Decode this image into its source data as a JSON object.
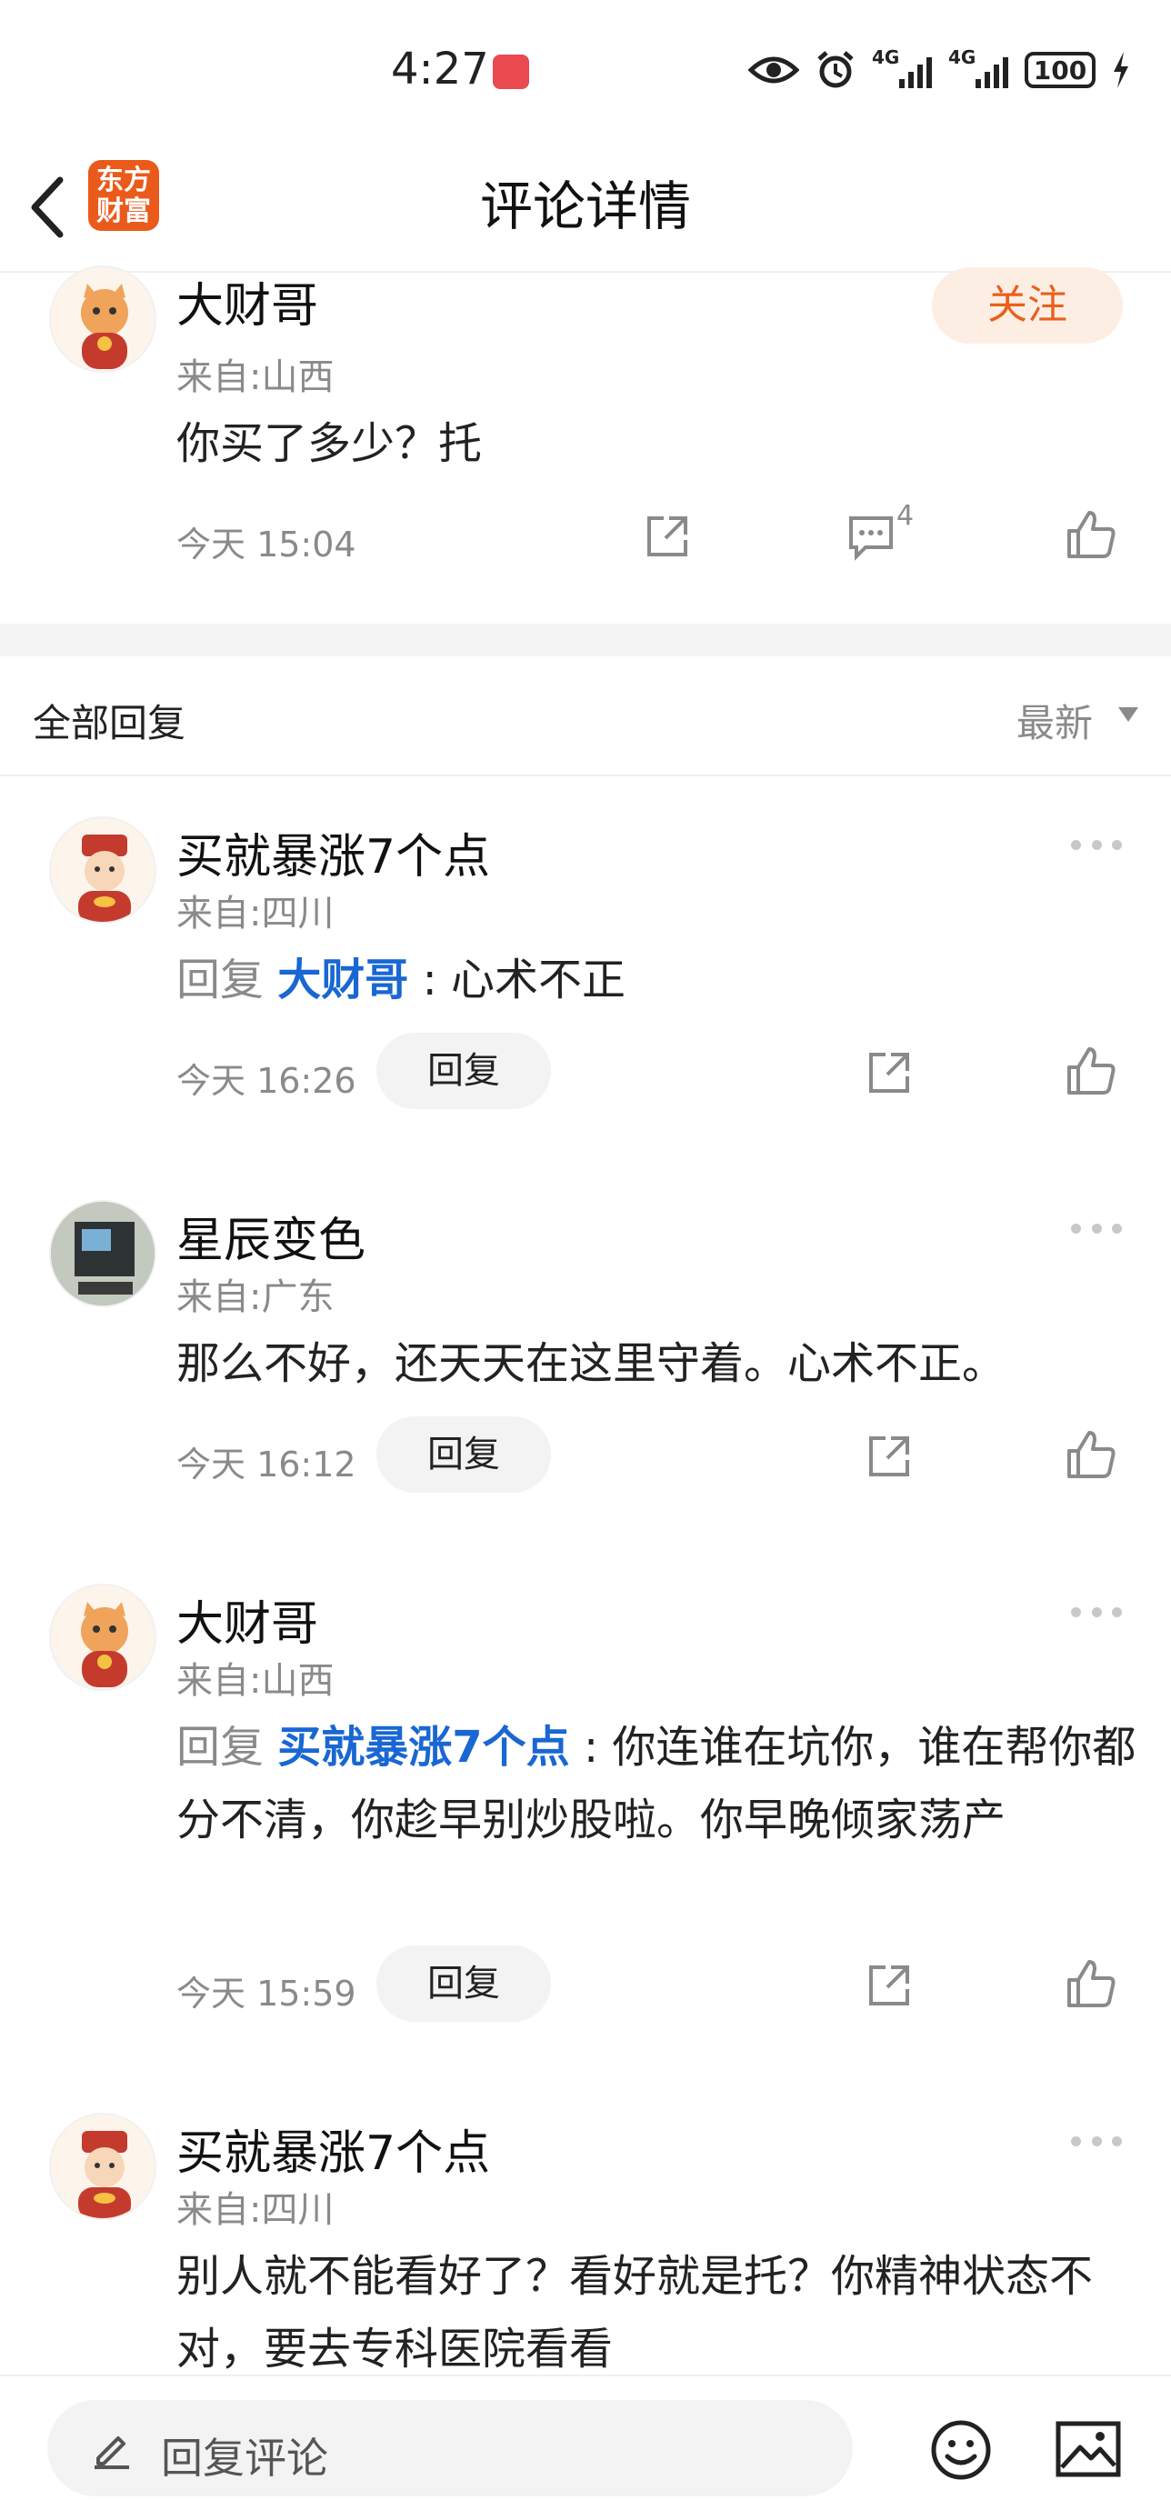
{
  "status_bar": {
    "time": "4:27",
    "battery": "100",
    "network": "4G"
  },
  "header": {
    "title": "评论详情",
    "logo_line1": "东方",
    "logo_line2": "财富"
  },
  "main_comment": {
    "author": "大财哥",
    "from": "来自:山西",
    "text": "你买了多少？托",
    "time": "今天 15:04",
    "comment_count": "4",
    "follow_label": "关注"
  },
  "section": {
    "title": "全部回复",
    "sort": "最新"
  },
  "reply_label": "回复",
  "replies": [
    {
      "author": "买就暴涨7个点",
      "from": "来自:四川",
      "prefix": "回复",
      "target": "大财哥",
      "text": ": 心术不正",
      "time": "今天 16:26"
    },
    {
      "author": "星辰变色",
      "from": "来自:广东",
      "text": "那么不好，还天天在这里守着。心术不正。",
      "time": "今天 16:12"
    },
    {
      "author": "大财哥",
      "from": "来自:山西",
      "prefix": "回复",
      "target": "买就暴涨7个点",
      "text": ": 你连谁在坑你，谁在帮你都分不清，你趁早别炒股啦。你早晚倾家荡产",
      "time": "今天 15:59"
    },
    {
      "author": "买就暴涨7个点",
      "from": "来自:四川",
      "text": "别人就不能看好了？看好就是托？你精神状态不对，要去专科医院看看"
    }
  ],
  "bottom_bar": {
    "placeholder": "回复评论"
  },
  "colors": {
    "accent": "#e8601c",
    "link": "#1967d2",
    "secondary": "#8a8a8a"
  }
}
